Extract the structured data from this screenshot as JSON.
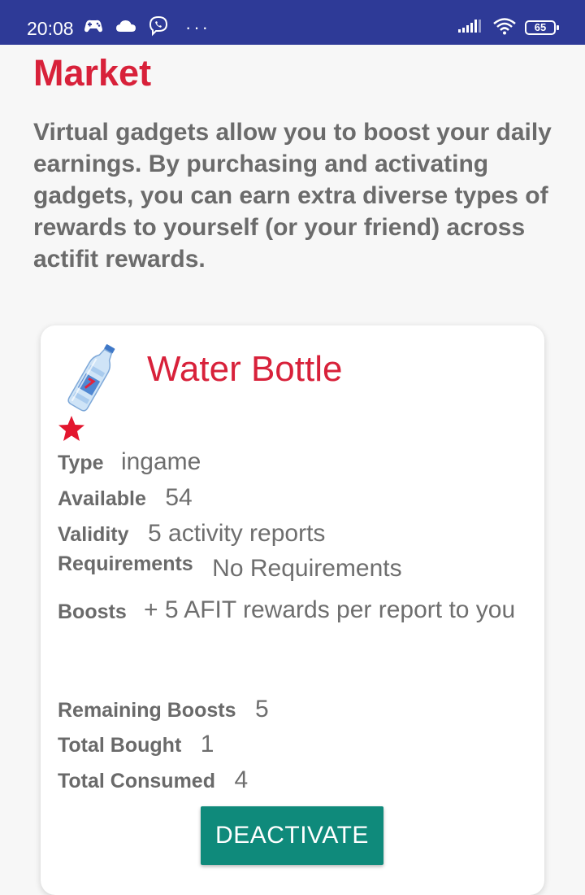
{
  "status_bar": {
    "time": "20:08",
    "battery": "65",
    "icons": [
      "game-controller-icon",
      "cloud-icon",
      "viber-icon",
      "more-dots-icon",
      "signal-icon",
      "wifi-icon",
      "battery-icon"
    ],
    "more": "···"
  },
  "page": {
    "title": "Market",
    "intro": "Virtual gadgets allow you to boost your daily earnings. By purchasing and activating gadgets, you can earn extra diverse types of rewards to yourself (or your friend) across actifit rewards."
  },
  "gadget": {
    "name": "Water Bottle",
    "icon": "water-bottle-icon",
    "rating_icon": "star-icon",
    "fields": {
      "type": {
        "label": "Type",
        "value": "ingame"
      },
      "available": {
        "label": "Available",
        "value": "54"
      },
      "validity": {
        "label": "Validity",
        "value": "5 activity reports"
      },
      "requirements": {
        "label": "Requirements",
        "value": "No Requirements"
      },
      "boosts": {
        "label": "Boosts",
        "value": "+ 5 AFIT rewards per report to you"
      },
      "remaining_boosts": {
        "label": "Remaining Boosts",
        "value": "5"
      },
      "total_bought": {
        "label": "Total Bought",
        "value": "1"
      },
      "total_consumed": {
        "label": "Total Consumed",
        "value": "4"
      }
    },
    "action_label": "DEACTIVATE"
  },
  "colors": {
    "status_bar": "#2e3a97",
    "accent_red": "#d8213a",
    "button_teal": "#0f8a7b",
    "background": "#f7f7f7",
    "text_gray": "#6a6a6a"
  }
}
